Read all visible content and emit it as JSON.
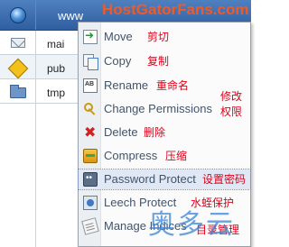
{
  "watermark": {
    "top_text": "HostGatorFans.com",
    "bottom_text": "奥多云"
  },
  "file_table": {
    "header_name": "www",
    "rows": [
      {
        "icon": "envelope-icon",
        "name": "mai"
      },
      {
        "icon": "warning-icon",
        "name": "pub"
      },
      {
        "icon": "folder-icon",
        "name": "tmp"
      }
    ]
  },
  "context_menu": {
    "items": [
      {
        "icon": "move-icon",
        "label": "Move",
        "note": "剪切"
      },
      {
        "icon": "copy-icon",
        "label": "Copy",
        "note": "复制"
      },
      {
        "icon": "rename-icon",
        "label": "Rename",
        "note": "重命名"
      },
      {
        "icon": "key-icon",
        "label": "Change Permissions",
        "note_line1": "修改",
        "note_line2": "权限"
      },
      {
        "icon": "delete-icon",
        "label": "Delete",
        "note": "删除"
      },
      {
        "icon": "compress-icon",
        "label": "Compress",
        "note": "压缩"
      },
      {
        "icon": "lock-icon",
        "label": "Password Protect",
        "note": "设置密码"
      },
      {
        "icon": "leech-icon",
        "label": "Leech Protect",
        "note": "水蛭保护"
      },
      {
        "icon": "indices-icon",
        "label": "Manage Indices",
        "note": "目录管理"
      }
    ],
    "highlighted_item": "Password Protect"
  }
}
